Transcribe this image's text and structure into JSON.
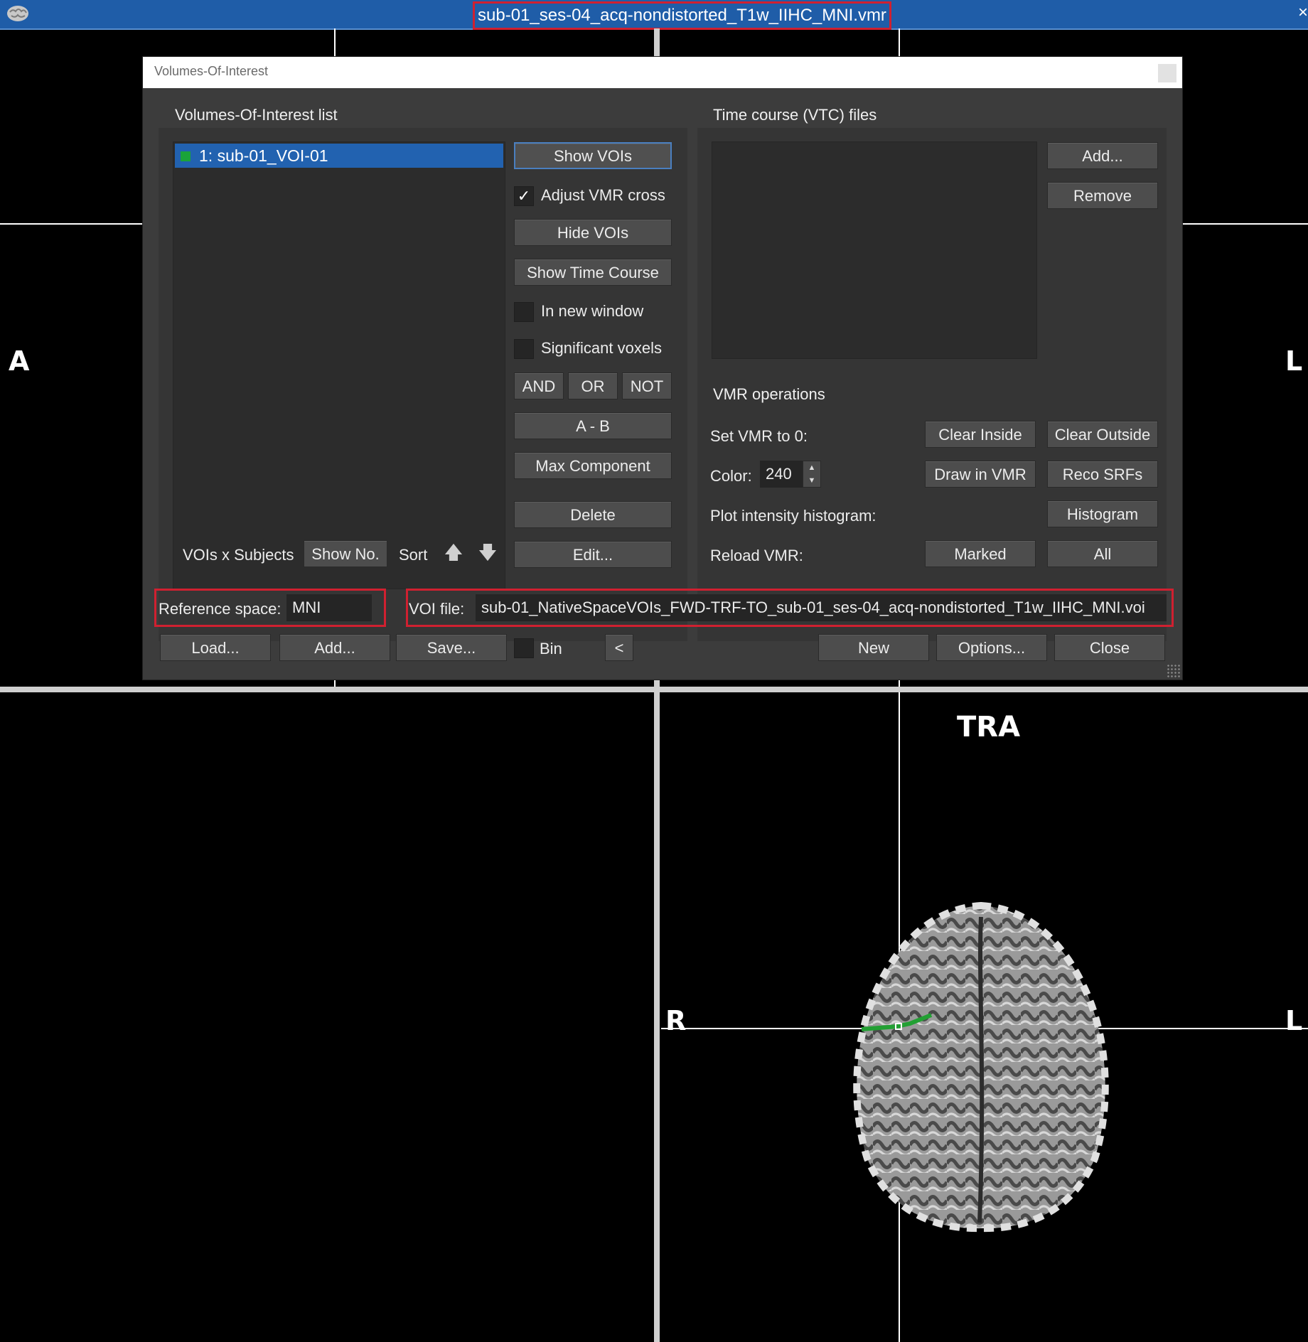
{
  "window": {
    "title": "sub-01_ses-04_acq-nondistorted_T1w_IIHC_MNI.vmr",
    "close_glyph": "×"
  },
  "viewer": {
    "orientation_left_top": "A",
    "orientation_right_top": "L",
    "orientation_left_tra": "R",
    "orientation_right_tra": "L",
    "view_label": "TRA"
  },
  "dialog": {
    "title": "Volumes-Of-Interest",
    "voi_list": {
      "heading": "Volumes-Of-Interest list",
      "items": [
        {
          "label": "1: sub-01_VOI-01",
          "color": "#1aa33a",
          "selected": true
        }
      ]
    },
    "voi_buttons": {
      "show_vois": "Show VOIs",
      "adjust_vmr_cross": "Adjust VMR cross",
      "adjust_vmr_cross_checked": true,
      "hide_vois": "Hide VOIs",
      "show_time_course": "Show Time Course",
      "in_new_window": "In new window",
      "significant_voxels": "Significant voxels",
      "and": "AND",
      "or": "OR",
      "not": "NOT",
      "a_minus_b": "A - B",
      "max_component": "Max Component",
      "delete": "Delete",
      "edit": "Edit..."
    },
    "list_footer": {
      "vois_x_subjects": "VOIs x Subjects",
      "show_no": "Show No.",
      "sort": "Sort",
      "sort_up_icon": "arrow-up-icon",
      "sort_down_icon": "arrow-down-icon"
    },
    "vtc": {
      "heading": "Time course (VTC) files",
      "add": "Add...",
      "remove": "Remove"
    },
    "vmr_ops": {
      "heading": "VMR operations",
      "set_vmr_label": "Set VMR to 0:",
      "clear_inside": "Clear Inside",
      "clear_outside": "Clear Outside",
      "color_label": "Color:",
      "color_value": "240",
      "draw_in_vmr": "Draw in VMR",
      "reco_srfs": "Reco SRFs",
      "plot_hist_label": "Plot intensity histogram:",
      "histogram": "Histogram",
      "reload_label": "Reload VMR:",
      "marked": "Marked",
      "all": "All"
    },
    "reference_space": {
      "label": "Reference space:",
      "value": "MNI"
    },
    "voi_file": {
      "label": "VOI file:",
      "value": "sub-01_NativeSpaceVOIs_FWD-TRF-TO_sub-01_ses-04_acq-nondistorted_T1w_IIHC_MNI.voi"
    },
    "bottom": {
      "load": "Load...",
      "add": "Add...",
      "save": "Save...",
      "bin": "Bin",
      "prev": "<",
      "new": "New",
      "options": "Options...",
      "close": "Close"
    }
  }
}
